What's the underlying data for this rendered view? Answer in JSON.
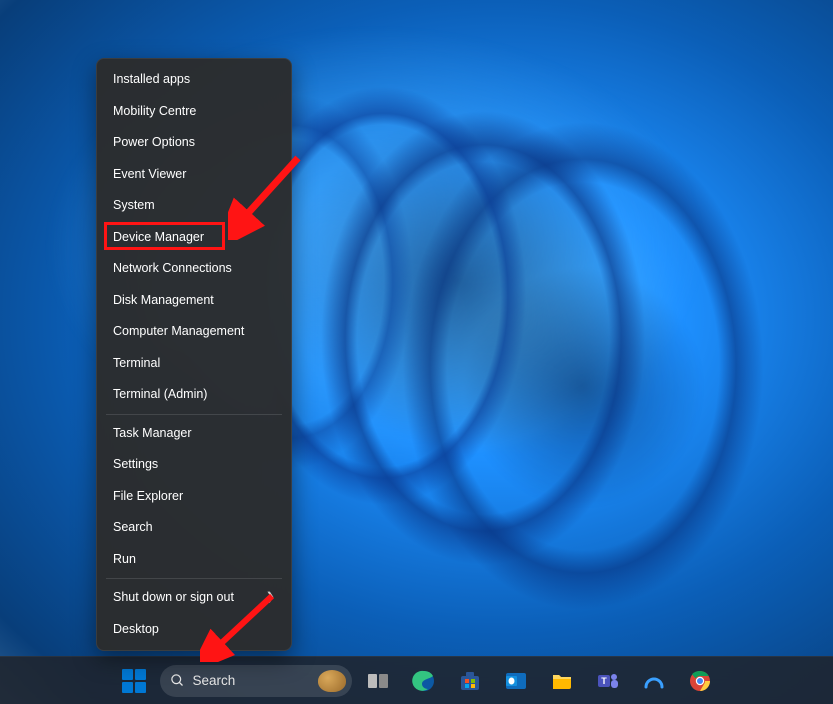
{
  "context_menu": {
    "items": [
      {
        "label": "Installed apps"
      },
      {
        "label": "Mobility Centre"
      },
      {
        "label": "Power Options"
      },
      {
        "label": "Event Viewer"
      },
      {
        "label": "System"
      },
      {
        "label": "Device Manager"
      },
      {
        "label": "Network Connections"
      },
      {
        "label": "Disk Management"
      },
      {
        "label": "Computer Management"
      },
      {
        "label": "Terminal"
      },
      {
        "label": "Terminal (Admin)"
      }
    ],
    "group2": [
      {
        "label": "Task Manager"
      },
      {
        "label": "Settings"
      },
      {
        "label": "File Explorer"
      },
      {
        "label": "Search"
      },
      {
        "label": "Run"
      }
    ],
    "group3": [
      {
        "label": "Shut down or sign out",
        "submenu": true
      },
      {
        "label": "Desktop"
      }
    ]
  },
  "search": {
    "placeholder": "Search"
  },
  "taskbar_apps": [
    {
      "name": "task-view"
    },
    {
      "name": "edge"
    },
    {
      "name": "microsoft-store"
    },
    {
      "name": "outlook"
    },
    {
      "name": "file-explorer"
    },
    {
      "name": "teams"
    },
    {
      "name": "app-generic"
    },
    {
      "name": "chrome"
    }
  ],
  "annotations": {
    "highlight_target": "Device Manager",
    "arrow_color": "#ff1414"
  }
}
